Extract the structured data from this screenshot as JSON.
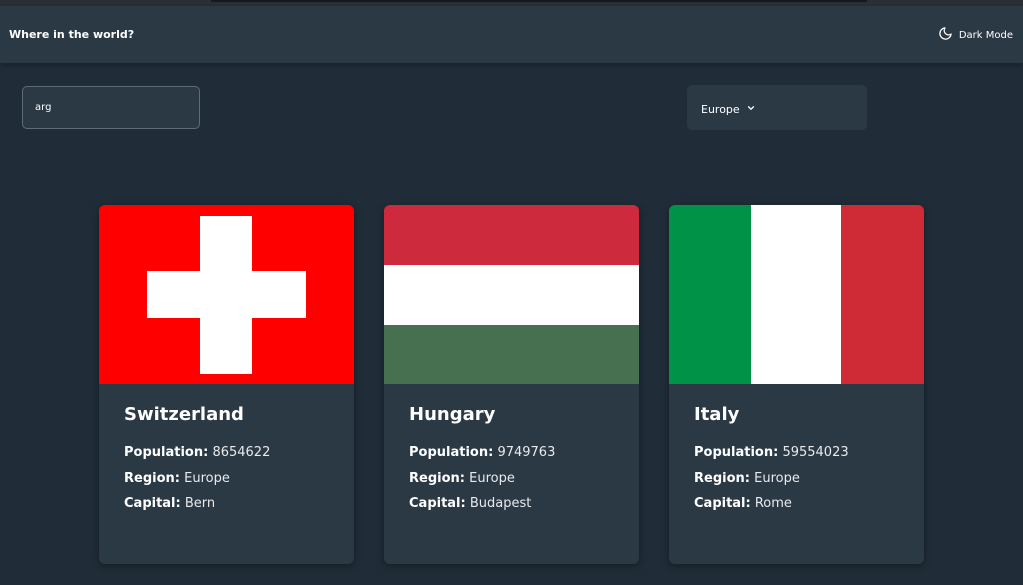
{
  "header": {
    "title": "Where in the world?",
    "dark_mode_label": "Dark Mode"
  },
  "search": {
    "value": "arg"
  },
  "filter": {
    "selected": "Europe"
  },
  "labels": {
    "population": "Population:",
    "region": "Region:",
    "capital": "Capital:"
  },
  "countries": [
    {
      "name": "Switzerland",
      "population": "8654622",
      "region": "Europe",
      "capital": "Bern"
    },
    {
      "name": "Hungary",
      "population": "9749763",
      "region": "Europe",
      "capital": "Budapest"
    },
    {
      "name": "Italy",
      "population": "59554023",
      "region": "Europe",
      "capital": "Rome"
    }
  ],
  "colors": {
    "background": "#202c37",
    "elements": "#2b3945",
    "swiss_red": "#ff0000",
    "hungary_red": "#cd2a3e",
    "hungary_green": "#477050",
    "italy_green": "#009246",
    "italy_red": "#ce2b37"
  }
}
